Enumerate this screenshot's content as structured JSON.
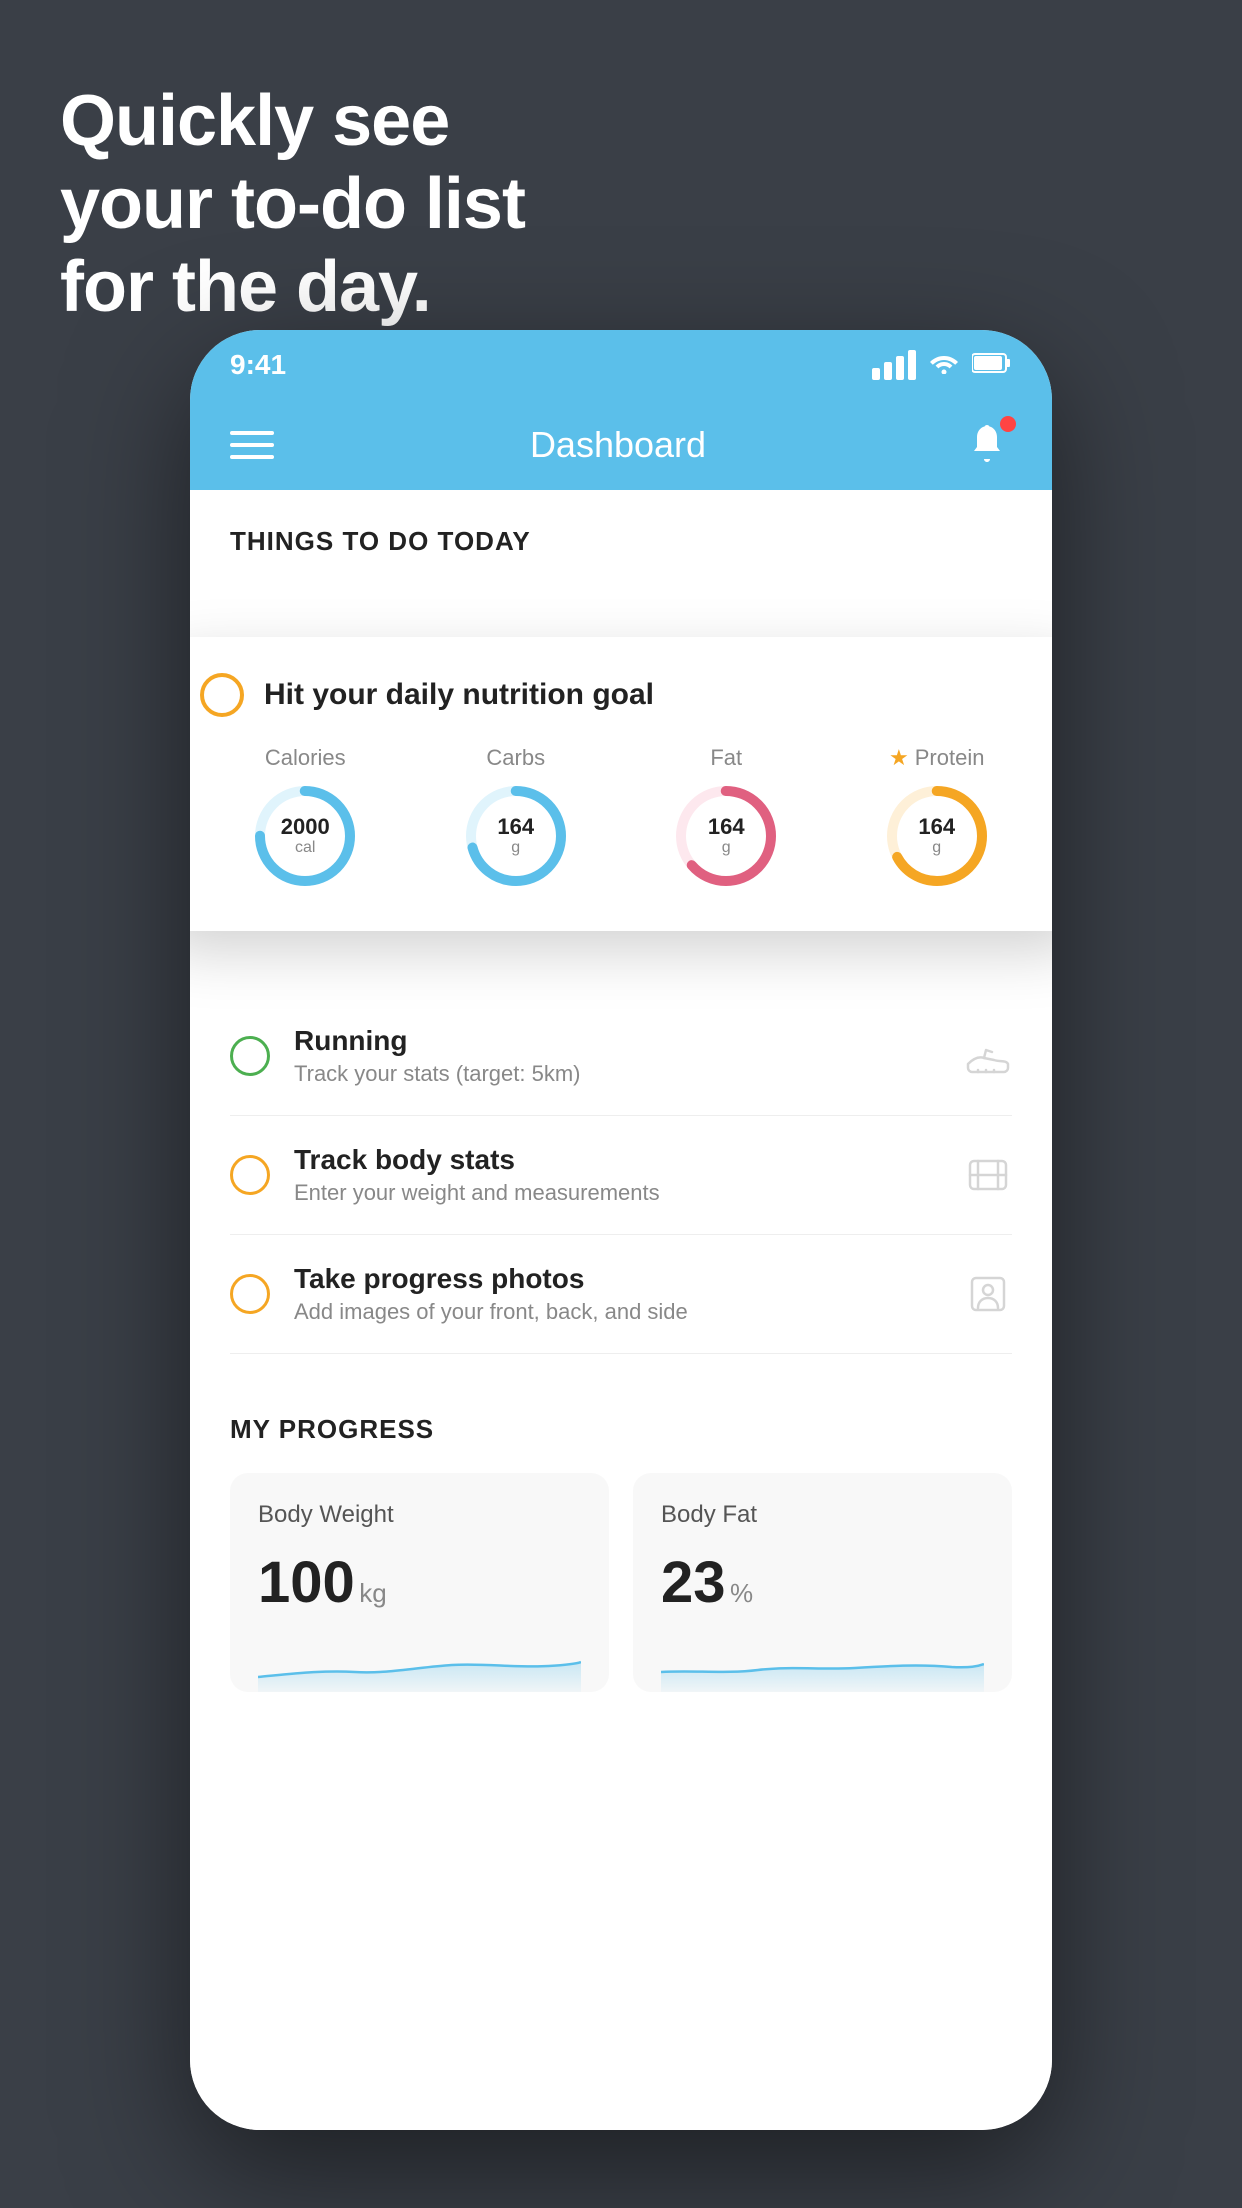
{
  "hero": {
    "line1": "Quickly see",
    "line2": "your to-do list",
    "line3": "for the day."
  },
  "statusBar": {
    "time": "9:41"
  },
  "navBar": {
    "title": "Dashboard"
  },
  "thingsToday": {
    "sectionHeader": "THINGS TO DO TODAY"
  },
  "nutritionCard": {
    "title": "Hit your daily nutrition goal",
    "items": [
      {
        "label": "Calories",
        "value": "2000",
        "unit": "cal",
        "color": "#5bbfea",
        "trackColor": "#e0f4fc"
      },
      {
        "label": "Carbs",
        "value": "164",
        "unit": "g",
        "color": "#5bbfea",
        "trackColor": "#e0f4fc"
      },
      {
        "label": "Fat",
        "value": "164",
        "unit": "g",
        "color": "#e06080",
        "trackColor": "#fde8ee"
      },
      {
        "label": "Protein",
        "value": "164",
        "unit": "g",
        "color": "#f5a623",
        "trackColor": "#fef0d8",
        "star": true
      }
    ]
  },
  "todoItems": [
    {
      "id": "running",
      "title": "Running",
      "subtitle": "Track your stats (target: 5km)",
      "checkColor": "green",
      "iconType": "shoe"
    },
    {
      "id": "body-stats",
      "title": "Track body stats",
      "subtitle": "Enter your weight and measurements",
      "checkColor": "yellow",
      "iconType": "scale"
    },
    {
      "id": "progress-photos",
      "title": "Take progress photos",
      "subtitle": "Add images of your front, back, and side",
      "checkColor": "yellow",
      "iconType": "person"
    }
  ],
  "progressSection": {
    "title": "MY PROGRESS",
    "cards": [
      {
        "title": "Body Weight",
        "value": "100",
        "unit": "kg",
        "chartColor": "#5bbfea"
      },
      {
        "title": "Body Fat",
        "value": "23",
        "unit": "%",
        "chartColor": "#5bbfea"
      }
    ]
  }
}
